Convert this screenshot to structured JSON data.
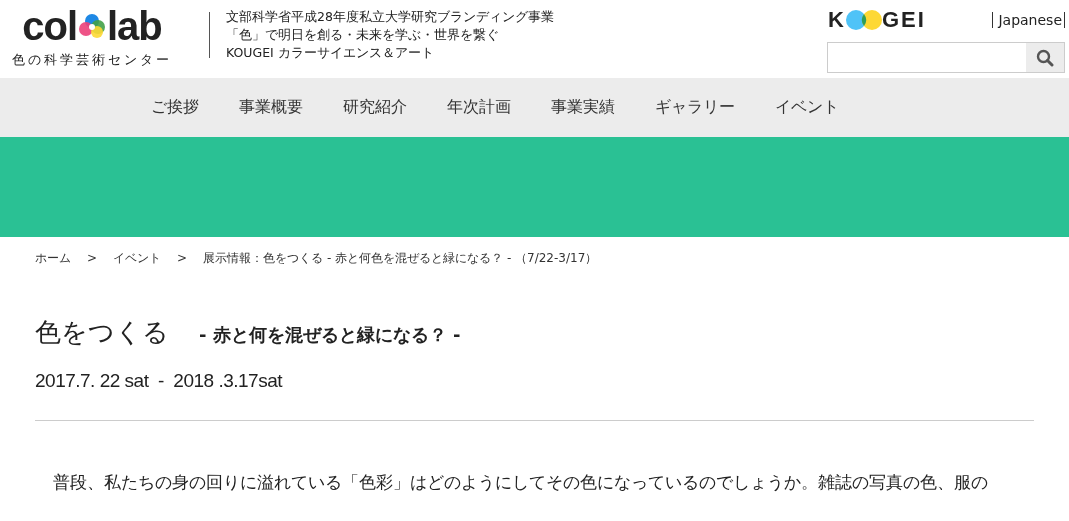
{
  "logo": {
    "left": "col",
    "right": "lab",
    "subtitle": "色の科学芸術センター"
  },
  "tagline": [
    "文部科学省平成28年度私立大学研究ブランディング事業",
    "「色」で明日を創る・未来を学ぶ・世界を繋ぐ",
    "KOUGEI カラーサイエンス＆アート"
  ],
  "brand": {
    "left": "K",
    "right": "GEI"
  },
  "language": "Japanese",
  "nav": [
    {
      "label": "ご挨拶",
      "selected": false
    },
    {
      "label": "事業概要",
      "selected": false
    },
    {
      "label": "研究紹介",
      "selected": false
    },
    {
      "label": "年次計画",
      "selected": false
    },
    {
      "label": "事業実績",
      "selected": false
    },
    {
      "label": "ギャラリー",
      "selected": false
    },
    {
      "label": "イベント",
      "selected": false
    }
  ],
  "breadcrumb": [
    "ホーム",
    "イベント",
    "展示情報：色をつくる - 赤と何色を混ぜると緑になる？ - （7/22-3/17）"
  ],
  "breadcrumb_separator": ">",
  "title": "色をつくる",
  "subtitle": "- 赤と何を混ぜると緑になる？ -",
  "dates": "2017.7. 22 sat  -  2018 .3.17sat",
  "body": "普段、私たちの身の回りに溢れている「色彩」はどのようにしてその色になっているのでしょうか。雑誌の写真の色、服の"
}
